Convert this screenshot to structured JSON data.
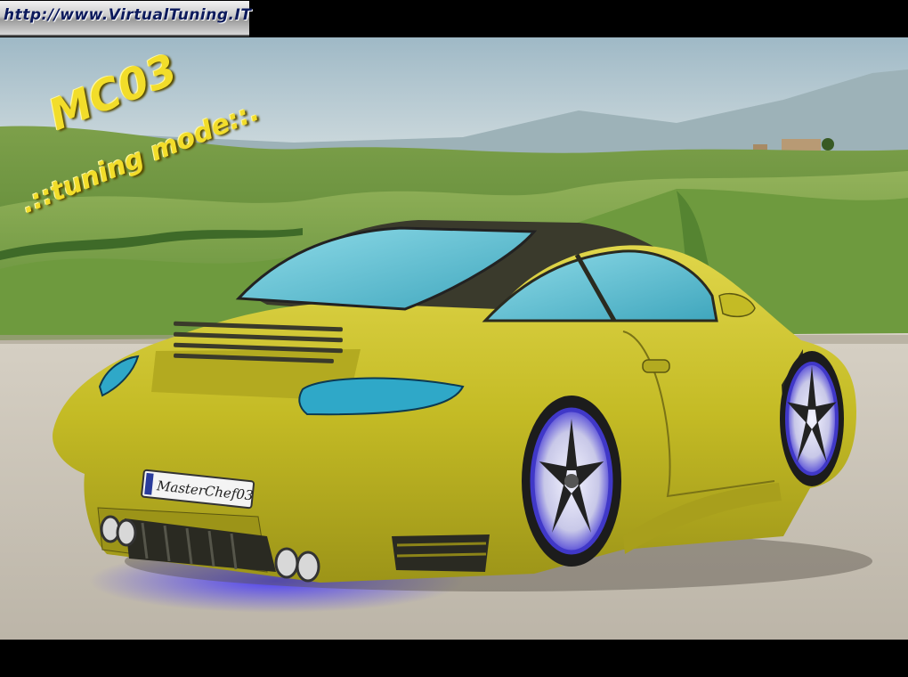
{
  "banner": {
    "url_text": "http://www.VirtualTuning.IT"
  },
  "captions": {
    "main": "MC03",
    "sub": ".::tuning mode::."
  },
  "license_plate": {
    "text": "MasterChef03"
  },
  "colors": {
    "car_body": "#c9c02a",
    "sky": "#b9cdd6",
    "hills": "#5d8a3a",
    "gravel": "#c9c3b8",
    "glass": "#6cc6d6",
    "underglow": "#3a2cff",
    "caption": "#f2dd2a"
  }
}
